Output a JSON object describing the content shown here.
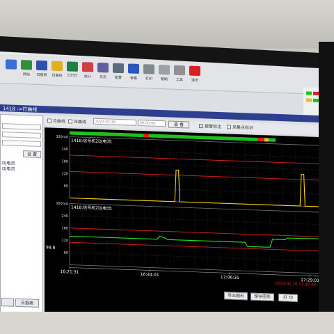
{
  "window": {
    "title": "1418 ->打曲线"
  },
  "toolbar": {
    "items": [
      {
        "label": "",
        "icon": "monitor-icon",
        "color": "#3a6fd8"
      },
      {
        "label": "网站",
        "icon": "network-icon",
        "color": "#2f8f3f"
      },
      {
        "label": "日报表",
        "icon": "report-icon",
        "color": "#3050b0"
      },
      {
        "label": "日曲线",
        "icon": "curve-icon",
        "color": "#e0b020"
      },
      {
        "label": "23/55",
        "icon": "graph-icon",
        "color": "#208040"
      },
      {
        "label": "统计",
        "icon": "stats-icon",
        "color": "#d04040"
      },
      {
        "label": "日志",
        "icon": "log-icon",
        "color": "#6060a0"
      },
      {
        "label": "配置",
        "icon": "config-icon",
        "color": "#5a6a7a"
      },
      {
        "label": "查看",
        "icon": "view-icon",
        "color": "#2a58c0"
      },
      {
        "label": "打印",
        "icon": "print-icon",
        "color": "#808890"
      },
      {
        "label": "帮助",
        "icon": "help-icon",
        "color": "#a0a0a8"
      },
      {
        "label": "工具",
        "icon": "tool-icon",
        "color": "#909098"
      },
      {
        "label": "退出",
        "icon": "exit-icon",
        "color": "#d82020"
      }
    ]
  },
  "left_panel": {
    "button": "设 置",
    "items": [
      "DJ电流",
      "DJ电流"
    ]
  },
  "controls": {
    "month_curve": "月曲线",
    "day_curve": "年曲线",
    "date_value": "2023-02-16",
    "time_value": "00:00:00",
    "search_button": "查 看",
    "show_marks": "报警标注",
    "show_points": "采集点标识"
  },
  "chart_data": [
    {
      "type": "line",
      "title": "1418:信号机2DJ电流:",
      "ylim": [
        0,
        300
      ],
      "yticks": [
        "300mA",
        "240",
        "180",
        "120",
        "60"
      ],
      "series": [
        {
          "color": "#ffd000",
          "x": [
            0,
            0.42,
            0.425,
            0.435,
            0.44,
            0.92,
            0.925,
            0.935,
            0.94,
            1
          ],
          "values": [
            0,
            0,
            155,
            155,
            0,
            0,
            155,
            155,
            0,
            0
          ]
        }
      ],
      "limit_lines": [
        {
          "value": 210,
          "color": "#e02020"
        },
        {
          "value": 130,
          "color": "#e02020"
        }
      ]
    },
    {
      "type": "line",
      "title": "1418:信号机2DJ电流:",
      "ylim": [
        0,
        300
      ],
      "yticks": [
        "300mA",
        "240",
        "180",
        "120",
        "60"
      ],
      "current_value": "98.8",
      "series": [
        {
          "color": "#22e022",
          "x": [
            0,
            0.35,
            0.36,
            0.38,
            0.39,
            0.7,
            0.71,
            0.8,
            0.81,
            0.86,
            0.87,
            1
          ],
          "values": [
            140,
            140,
            155,
            148,
            140,
            140,
            120,
            120,
            160,
            160,
            168,
            170
          ]
        }
      ],
      "limit_lines": [
        {
          "value": 180,
          "color": "#e02020"
        },
        {
          "value": 110,
          "color": "#e02020"
        }
      ]
    }
  ],
  "time_axis": {
    "labels": [
      "16:21:31",
      "16:44:01",
      "17:06:31",
      "17:29:01"
    ],
    "cursor_time": "2023-02-16 17:38:49"
  },
  "bottom": {
    "tabs": [
      "",
      "日报表"
    ],
    "buttons": [
      "导出图形",
      "保存图形",
      "打 印"
    ]
  },
  "colors": {
    "chart_bg": "#000000",
    "grid": "#555555",
    "status_ok": "#1ec21e",
    "status_alarm": "#e02020"
  }
}
